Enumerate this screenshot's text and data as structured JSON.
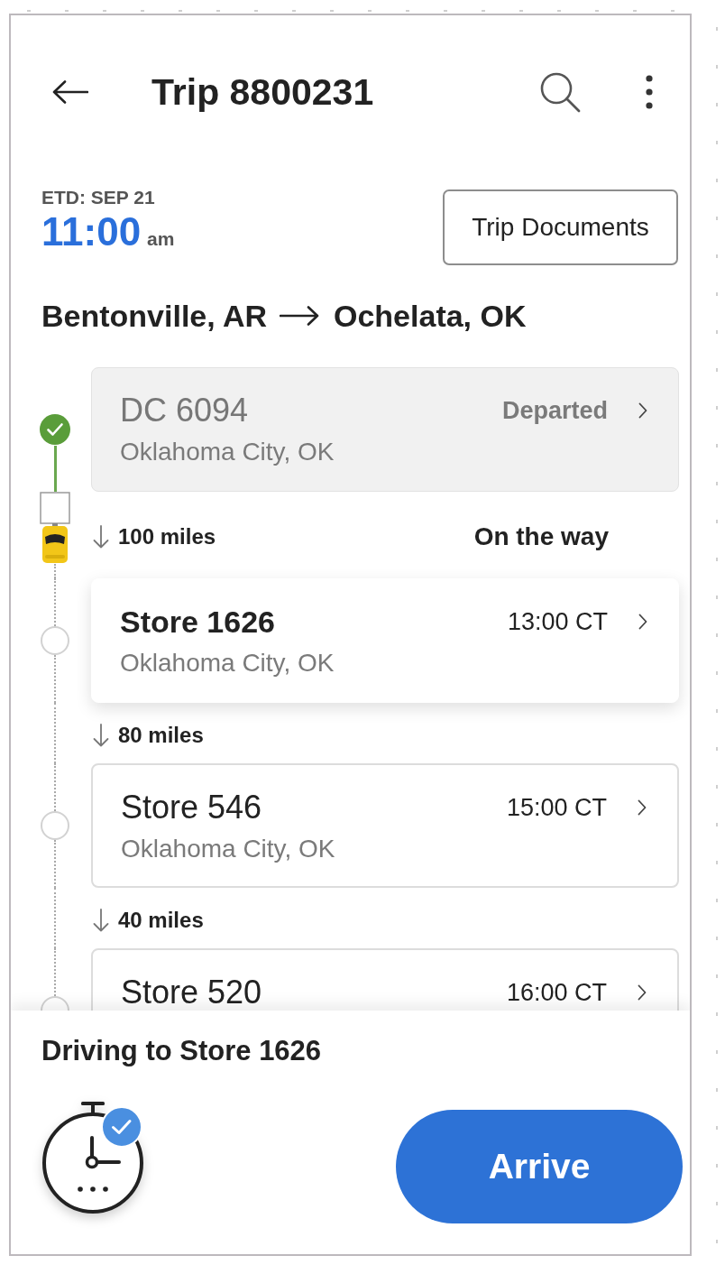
{
  "header": {
    "title": "Trip 8800231"
  },
  "etd": {
    "label": "ETD: SEP 21",
    "time": "11:00",
    "meridiem": "am"
  },
  "documents_button": {
    "label": "Trip Documents"
  },
  "route": {
    "origin": "Bentonville, AR",
    "destination": "Ochelata, OK"
  },
  "stops": [
    {
      "kind": "departed",
      "name": "DC 6094",
      "location": "Oklahoma City, OK",
      "status": "Departed",
      "leg": {
        "distance": "100 miles",
        "note": "On the way",
        "truck": true
      }
    },
    {
      "kind": "current",
      "name": "Store 1626",
      "location": "Oklahoma City, OK",
      "eta": "13:00 CT",
      "leg": {
        "distance": "80 miles",
        "truck": false
      }
    },
    {
      "kind": "upcoming",
      "name": "Store 546",
      "location": "Oklahoma City, OK",
      "eta": "15:00 CT",
      "leg": {
        "distance": "40 miles",
        "truck": false
      }
    },
    {
      "kind": "upcoming",
      "name": "Store 520",
      "eta": "16:00 CT"
    }
  ],
  "footer": {
    "message": "Driving to Store 1626",
    "timer_checked": true,
    "button": "Arrive"
  }
}
